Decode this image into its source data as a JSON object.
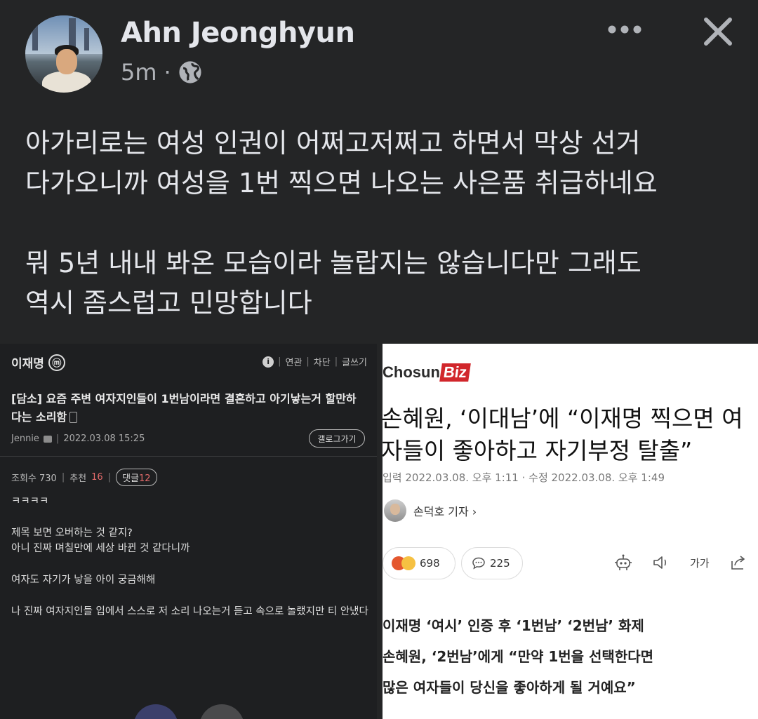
{
  "post": {
    "author": "Ahn Jeonghyun",
    "time": "5m",
    "separator": "·",
    "privacy_icon": "globe-icon",
    "text": "아가리로는 여성 인권이 어쩌고저쩌고 하면서 막상 선거\n다가오니까 여성을 1번 찍으면 나오는 사은품 취급하네요\n\n뭐 5년 내내 봐온 모습이라 놀랍지는 않습니다만 그래도\n역시 좀스럽고 민망합니다"
  },
  "header_icons": {
    "more": "more-icon",
    "close": "close-icon"
  },
  "left_screenshot": {
    "board": "이재명",
    "board_logo": "ⓜ",
    "links": [
      "연관",
      "차단",
      "글쓰기"
    ],
    "title": "[담소] 요즘 주변 여자지인들이 1번남이라면 결혼하고 아기낳는거 할만하다는 소리함",
    "author": "Jennie",
    "datetime": "2022.03.08 15:25",
    "gallery_button": "갤로그가기",
    "views_label": "조회수 730",
    "recommend_label": "추천",
    "recommend_count": "16",
    "comments_label": "댓글",
    "comments_count": "12",
    "body": [
      "ㅋㅋㅋㅋ",
      "",
      "제목 보면 오버하는 것 같지?",
      "아니 진짜 며칠만에 세상 바뀐 것 같다니까",
      "",
      "여자도 자기가 낳을 아이 궁금해해",
      "",
      "나 진짜 여자지인들 입에서 스스로 저 소리 나오는거 듣고 속으로 놀랬지만 티 안냈다"
    ]
  },
  "right_screenshot": {
    "logo_part1": "Chosun",
    "logo_part2": "Biz",
    "title_line1": "손혜원, ‘이대남’에 “이재명 찍으면 여",
    "title_line2": "자들이 좋아하고 자기부정 탈출”",
    "dates": "입력 2022.03.08. 오후 1:11 · 수정 2022.03.08. 오후 1:49",
    "reporter": "손덕호 기자 ›",
    "reactions_count": "698",
    "comments_count": "225",
    "font_label": "가가",
    "subheads": [
      "이재명 ‘여시’ 인증 후 ‘1번남’ ‘2번남’ 화제",
      "손혜원, ‘2번남’에게 “만약 1번을 선택한다면",
      "많은 여자들이 당신을 좋아하게 될 거예요”"
    ]
  },
  "colors": {
    "background": "#242526",
    "text_primary": "#e4e6eb",
    "text_secondary": "#b0b3b8",
    "chosun_red": "#d1262b"
  }
}
